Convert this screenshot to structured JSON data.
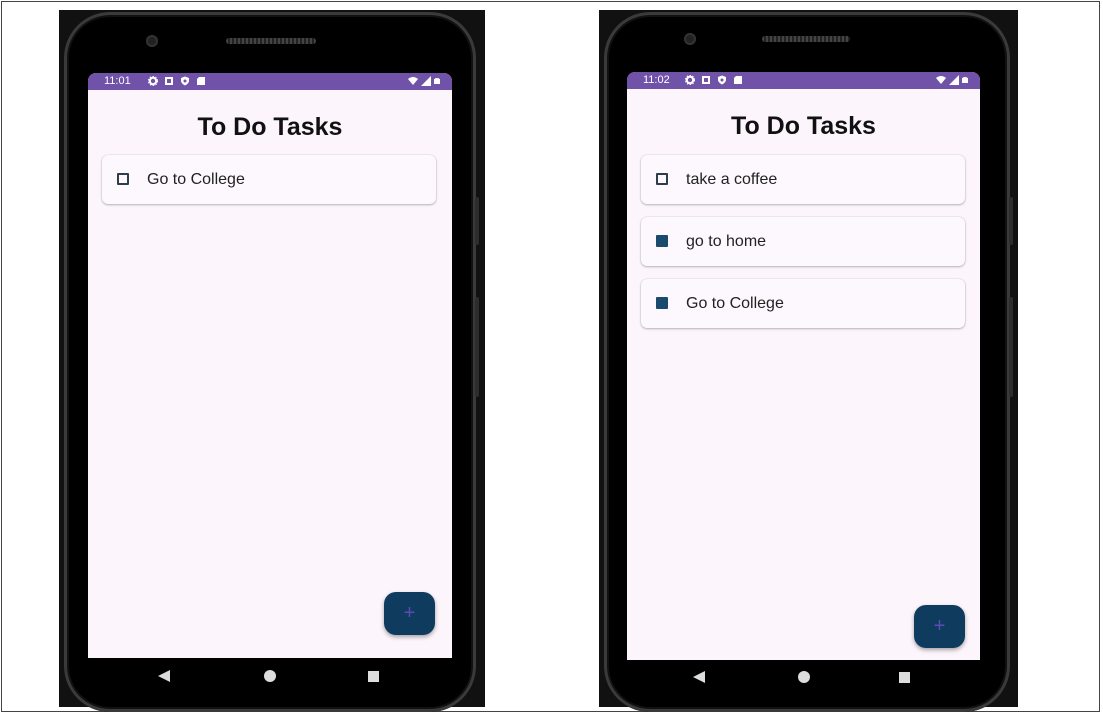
{
  "phones": [
    {
      "status_time": "11:01",
      "title": "To Do Tasks",
      "tasks": [
        {
          "label": "Go to College",
          "checked": false
        }
      ],
      "fab_label": "+"
    },
    {
      "status_time": "11:02",
      "title": "To Do Tasks",
      "tasks": [
        {
          "label": "take a coffee",
          "checked": false
        },
        {
          "label": "go to home",
          "checked": true
        },
        {
          "label": "Go to College",
          "checked": true
        }
      ],
      "fab_label": "+"
    }
  ],
  "colors": {
    "status_bar": "#7052a8",
    "screen_bg": "#fcf5fc",
    "checkbox_checked": "#1a4a6e",
    "fab": "#0f3b5f"
  },
  "icons": [
    "settings-icon",
    "notification-icon",
    "shield-icon",
    "sd-card-icon",
    "wifi-icon",
    "signal-icon",
    "battery-icon",
    "back-icon",
    "home-icon",
    "recents-icon"
  ]
}
